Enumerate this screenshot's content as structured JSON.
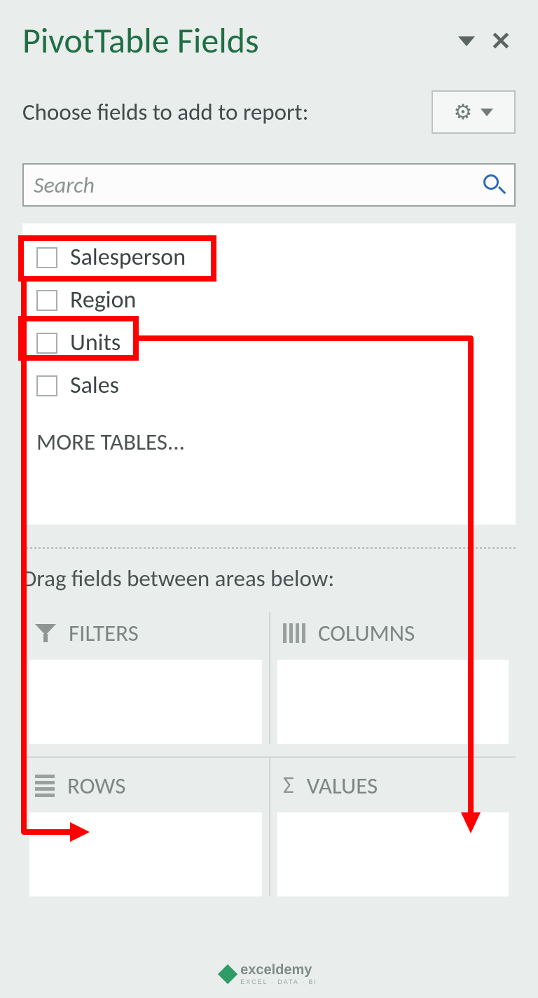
{
  "title": "PivotTable Fields",
  "instruction": "Choose fields to add to report:",
  "search": {
    "placeholder": "Search"
  },
  "fields": {
    "items": [
      {
        "label": "Salesperson"
      },
      {
        "label": "Region"
      },
      {
        "label": "Units"
      },
      {
        "label": "Sales"
      }
    ],
    "more": "MORE TABLES..."
  },
  "drag_instruction": "Drag fields between areas below:",
  "areas": {
    "filters": "FILTERS",
    "columns": "COLUMNS",
    "rows": "ROWS",
    "values": "VALUES"
  },
  "watermark": {
    "name": "exceldemy",
    "sub": "EXCEL · DATA · BI"
  }
}
